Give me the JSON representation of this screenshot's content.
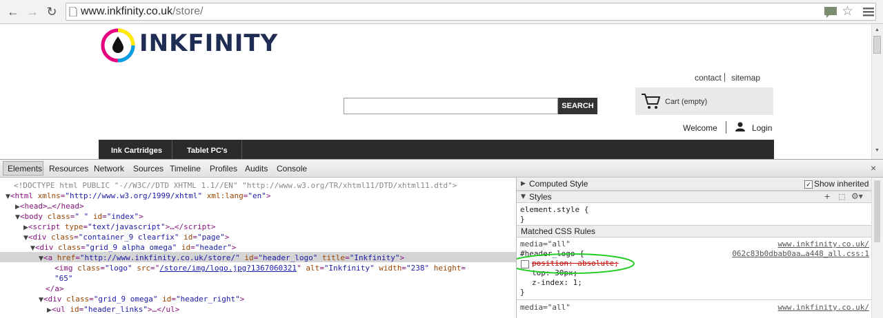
{
  "browser": {
    "url_domain": "www.inkfinity.co.uk",
    "url_path": "/store/"
  },
  "page": {
    "logo_text": "INKFINITY",
    "toplinks": {
      "contact": "contact",
      "sitemap": "sitemap"
    },
    "search_button": "SEARCH",
    "cart_label": "Cart (empty)",
    "welcome": "Welcome",
    "login": "Login",
    "nav": [
      "Ink Cartridges",
      "Tablet PC's"
    ]
  },
  "devtools": {
    "tabs": [
      "Elements",
      "Resources",
      "Network",
      "Sources",
      "Timeline",
      "Profiles",
      "Audits",
      "Console"
    ],
    "elements": {
      "doctype": "<!DOCTYPE html PUBLIC \"-//W3C//DTD XHTML 1.1//EN\" \"http://www.w3.org/TR/xhtml11/DTD/xhtml11.dtd\">",
      "html_xmlns": "\"http://www.w3.org/1999/xhtml\"",
      "html_lang": "\"en\"",
      "head": "<head>…</head>",
      "body_class": "\" \"",
      "body_id": "\"index\"",
      "script_type": "\"text/javascript\"",
      "div1_class": "\"container_9 clearfix\"",
      "div1_id": "\"page\"",
      "div2_class": "\"grid_9 alpha omega\"",
      "div2_id": "\"header\"",
      "a_href": "\"http://www.inkfinity.co.uk/store/\"",
      "a_id": "\"header_logo\"",
      "a_title": "\"Inkfinity\"",
      "img_class": "\"logo\"",
      "img_src": "/store/img/logo.jpg?1367060321",
      "img_alt": "\"Inkfinity\"",
      "img_width": "\"238\"",
      "img_height": "\"65\"",
      "div3_class": "\"grid_9 omega\"",
      "div3_id": "\"header_right\"",
      "ul_id": "\"header_links\""
    },
    "styles": {
      "computed_style": "Computed Style",
      "show_inherited": "Show inherited",
      "styles_label": "Styles",
      "element_style": "element.style {",
      "close_brace": "}",
      "matched": "Matched CSS Rules",
      "media": "media=\"all\"",
      "source_link_1": "www.inkfinity.co.uk/",
      "selector": "#header_logo {",
      "source_link_2": "062c83b0dbab0aa…a448_all.css:1",
      "prop1": "position: absolute;",
      "prop2": "top: 30px;",
      "prop3": "z-index: 1;",
      "media2": "media=\"all\"",
      "source_link_3": "www.inkfinity.co.uk/"
    }
  },
  "colors": {
    "nav_bg": "#2b2b2b",
    "selection_bg": "#d4d4d4",
    "highlight_ellipse": "#22cc22"
  }
}
